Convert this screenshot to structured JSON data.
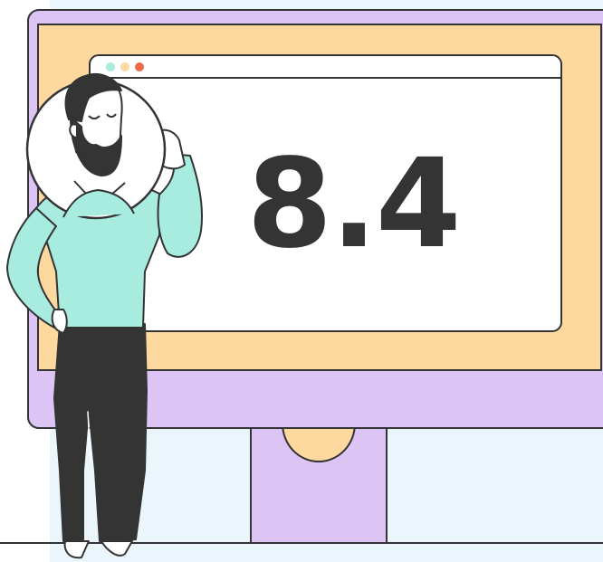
{
  "score": {
    "value": "8.4"
  },
  "window": {
    "dots": [
      {
        "color": "#a8ebdf"
      },
      {
        "color": "#fdd9a0"
      },
      {
        "color": "#ee6a48"
      }
    ]
  },
  "colors": {
    "backdrop": "#eaf6fc",
    "monitor": "#dcc5f5",
    "screen": "#fdd9a0",
    "panel": "#ffffff",
    "outline": "#343434",
    "sweater": "#a8ebdf",
    "skin": "#ffffff",
    "hair": "#343434"
  },
  "icons": [
    "monitor-illustration",
    "browser-window-icon",
    "person-illustration",
    "magnifier-lens-icon"
  ]
}
